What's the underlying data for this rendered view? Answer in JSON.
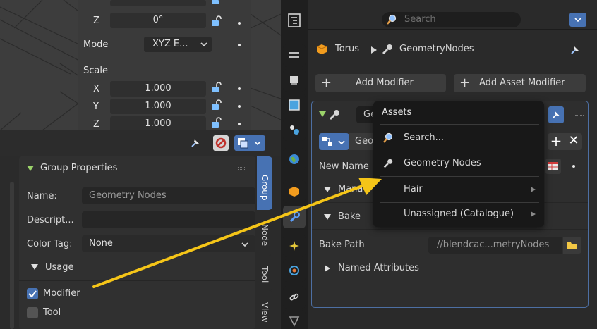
{
  "viewport": {
    "z_label": "Z",
    "z_value": "0°",
    "mode_label": "Mode",
    "mode_value": "XYZ E...",
    "scale_label": "Scale",
    "x_label": "X",
    "x_value": "1.000",
    "y_label": "Y",
    "y_value": "1.000",
    "z2_label": "Z",
    "z2_value": "1.000"
  },
  "group_panel": {
    "header": "Group Properties",
    "name_label": "Name:",
    "name_value": "Geometry Nodes",
    "description_label": "Descript...",
    "description_value": "",
    "color_tag_label": "Color Tag:",
    "color_tag_value": "None",
    "usage_header": "Usage",
    "modifier_label": "Modifier",
    "modifier_checked": true,
    "tool_label": "Tool",
    "tool_checked": false
  },
  "side_tabs": [
    "Group",
    "Node",
    "Tool",
    "View"
  ],
  "properties": {
    "search_placeholder": "Search",
    "object_name": "Torus",
    "modifier_name": "GeometryNodes",
    "add_modifier_label": "Add Modifier",
    "add_asset_modifier_label": "Add Asset Modifier",
    "header_name_partial": "Ge",
    "node_group_partial": "Geo",
    "new_name_label": "New Name",
    "manage_partial": "Mana",
    "bake_label": "Bake",
    "bake_path_label": "Bake Path",
    "bake_path_value": "//blendcac...metryNodes",
    "named_attributes_label": "Named Attributes"
  },
  "menu": {
    "title": "Assets",
    "items": [
      "Search...",
      "Geometry Nodes",
      "Hair",
      "Unassigned (Catalogue)"
    ]
  },
  "colors": {
    "accent": "#4772b3",
    "arrow": "#f5c518",
    "bg": "#2a2a2a"
  }
}
